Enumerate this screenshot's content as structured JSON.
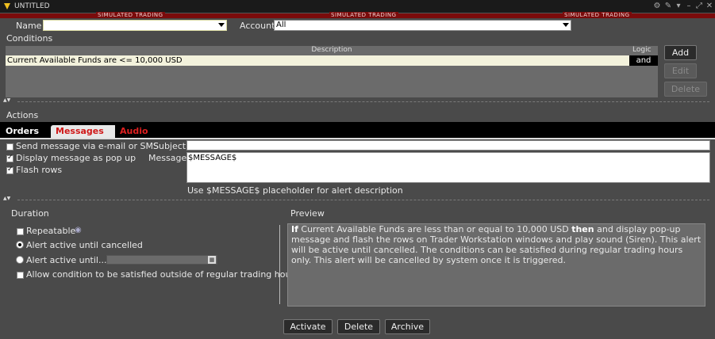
{
  "window": {
    "title": "UNTITLED"
  },
  "simulated": {
    "label": "SIMULATED TRADING"
  },
  "form": {
    "name_label": "Name",
    "name_value": "",
    "account_label": "Account",
    "account_value": "All"
  },
  "conditions": {
    "section_label": "Conditions",
    "description_header": "Description",
    "logic_header": "Logic",
    "rows": [
      {
        "description": "Current Available Funds are <= 10,000 USD",
        "logic": "and"
      }
    ],
    "buttons": {
      "add": "Add",
      "edit": "Edit",
      "delete": "Delete"
    }
  },
  "actions": {
    "section_label": "Actions",
    "tabs": [
      {
        "label": "Orders"
      },
      {
        "label": "Messages"
      },
      {
        "label": "Audio"
      }
    ],
    "send_message_label": "Send message via e-mail or SMS",
    "display_popup_label": "Display message as pop up",
    "flash_rows_label": "Flash rows",
    "subject_label": "Subject",
    "subject_value": "",
    "message_label": "Message",
    "message_value": "$MESSAGE$",
    "hint": "Use $MESSAGE$ placeholder for alert description"
  },
  "duration": {
    "label": "Duration",
    "repeatable": "Repeatable",
    "active_until_cancelled": "Alert active until cancelled",
    "active_until": "Alert active until...",
    "outside_hours": "Allow condition to be satisfied outside of regular trading hours"
  },
  "preview": {
    "label": "Preview",
    "lead": "If",
    "part1": " Current Available Funds are less than or equal to 10,000 USD ",
    "then": "then",
    "part2": " and display pop-up message and flash the rows on Trader Workstation windows and play sound (Siren). This alert will be active until cancelled. The conditions can be satisfied during regular trading hours only. This alert will be cancelled by system once it is triggered."
  },
  "footer": {
    "activate": "Activate",
    "delete": "Delete",
    "archive": "Archive"
  },
  "colors": {
    "accent_red": "#7a0b0b",
    "tab_messages": "#e02020",
    "tab_audio": "#e02020",
    "background": "#4a4a4a"
  }
}
